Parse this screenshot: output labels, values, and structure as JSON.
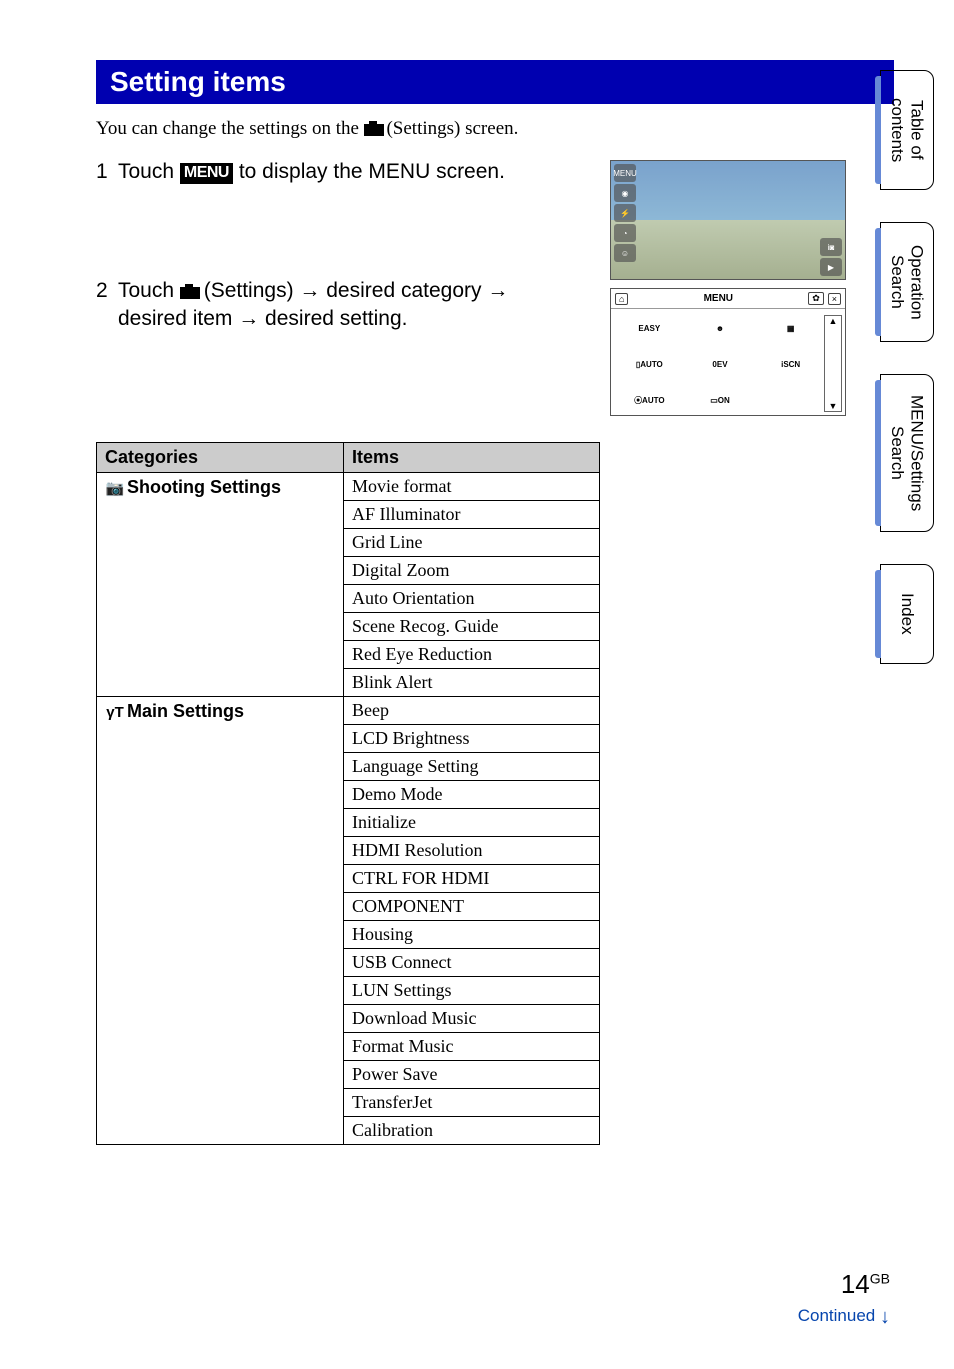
{
  "title": "Setting items",
  "intro_pre": "You can change the settings on the ",
  "intro_post": " (Settings) screen.",
  "steps": [
    {
      "num": "1",
      "pre": "Touch ",
      "menu_icon": "MENU",
      "post": " to display the MENU screen."
    },
    {
      "num": "2",
      "pre": "Touch ",
      "post_a": " (Settings) ",
      "arrow": "→",
      "cat": " desired category ",
      "post_b": "desired item ",
      "post_c": " desired setting."
    }
  ],
  "screenshot2": {
    "label": "MENU",
    "cells": [
      "EASY",
      "☻",
      "▦",
      "▯AUTO",
      "0EV",
      "iSCN",
      "⦿AUTO",
      "▭ON",
      ""
    ]
  },
  "table": {
    "headers": [
      "Categories",
      "Items"
    ],
    "groups": [
      {
        "icon": "📷",
        "name": "Shooting Settings",
        "items": [
          "Movie format",
          "AF Illuminator",
          "Grid Line",
          "Digital Zoom",
          "Auto Orientation",
          "Scene Recog. Guide",
          "Red Eye Reduction",
          "Blink Alert"
        ]
      },
      {
        "icon": "γT",
        "name": "Main Settings",
        "items": [
          "Beep",
          "LCD Brightness",
          "Language Setting",
          "Demo Mode",
          "Initialize",
          "HDMI Resolution",
          "CTRL FOR HDMI",
          "COMPONENT",
          "Housing",
          "USB Connect",
          "LUN Settings",
          "Download Music",
          "Format Music",
          "Power Save",
          "TransferJet",
          "Calibration"
        ]
      }
    ]
  },
  "tabs": [
    "Table of contents",
    "Operation Search",
    "MENU/Settings Search",
    "Index"
  ],
  "page_number": "14",
  "page_suffix": "GB",
  "continued": "Continued",
  "continued_arrow": "↓"
}
